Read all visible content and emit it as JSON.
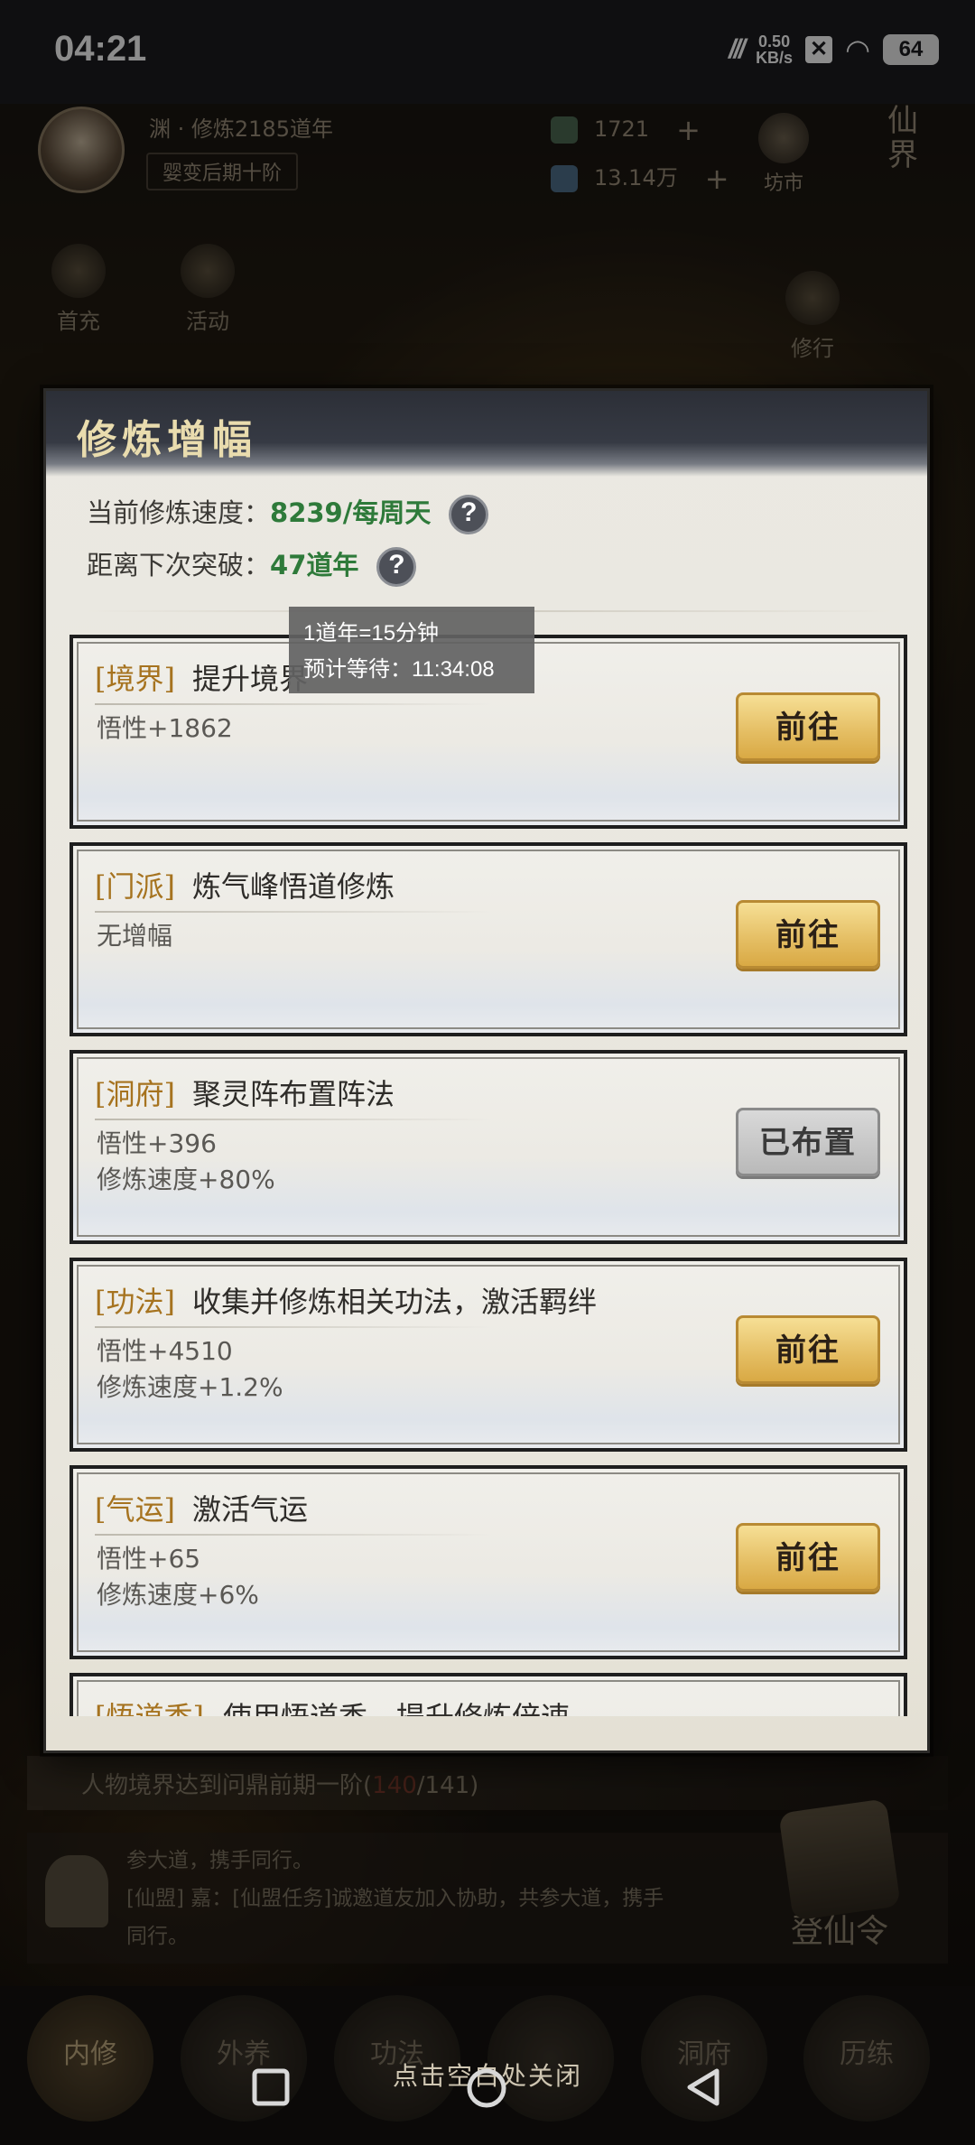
{
  "status": {
    "time": "04:21",
    "speed": "0.50",
    "speed_unit": "KB/s",
    "battery": "64"
  },
  "player": {
    "name": "渊 · 修炼2185道年",
    "rank": "婴变后期十阶"
  },
  "resources": [
    {
      "value": "1721"
    },
    {
      "value": "13.14万"
    }
  ],
  "top_icons": {
    "market": "坊市",
    "realm": "仙界",
    "first_charge": "首充",
    "activity": "活动",
    "practice": "修行"
  },
  "modal": {
    "title": "修炼增幅",
    "speed_label": "当前修炼速度：",
    "speed_value": "8239/每周天",
    "next_label": "距离下次突破：",
    "next_value": "47道年",
    "tooltip_line1": "1道年=15分钟",
    "tooltip_line2": "预计等待：11:34:08"
  },
  "cards": [
    {
      "tag": "[境界]",
      "title": "提升境界",
      "bonus1": "悟性+1862",
      "bonus2": "",
      "button": "前往"
    },
    {
      "tag": "[门派]",
      "title": "炼气峰悟道修炼",
      "bonus1": "无增幅",
      "bonus2": "",
      "button": "前往"
    },
    {
      "tag": "[洞府]",
      "title": "聚灵阵布置阵法",
      "bonus1": "悟性+396",
      "bonus2": "修炼速度+80%",
      "button": "已布置"
    },
    {
      "tag": "[功法]",
      "title": "收集并修炼相关功法，激活羁绊",
      "bonus1": "悟性+4510",
      "bonus2": "修炼速度+1.2%",
      "button": "前往"
    },
    {
      "tag": "[气运]",
      "title": "激活气运",
      "bonus1": "悟性+65",
      "bonus2": "修炼速度+6%",
      "button": "前往"
    },
    {
      "tag": "[悟道香]",
      "title": "使用悟道香，提升修炼倍速",
      "bonus1": "",
      "bonus2": "",
      "button": ""
    }
  ],
  "quest": {
    "text_before": "人物境界达到问鼎前期一阶(",
    "progress": "140",
    "text_after": "/141)"
  },
  "chat": {
    "line": "参大道，携手同行。",
    "message": "[仙盟] 嘉：[仙盟任务]诚邀道友加入协助，共参大道，携手同行。"
  },
  "dengxianling": "登仙令",
  "nav": [
    "内修",
    "外养",
    "功法",
    "",
    "洞府",
    "",
    "历练"
  ],
  "close_hint": "点击空白处关闭",
  "colors": {
    "accent_gold": "#e4bd62",
    "green_value": "#2e7a3a",
    "tag_brown": "#a6731f"
  }
}
